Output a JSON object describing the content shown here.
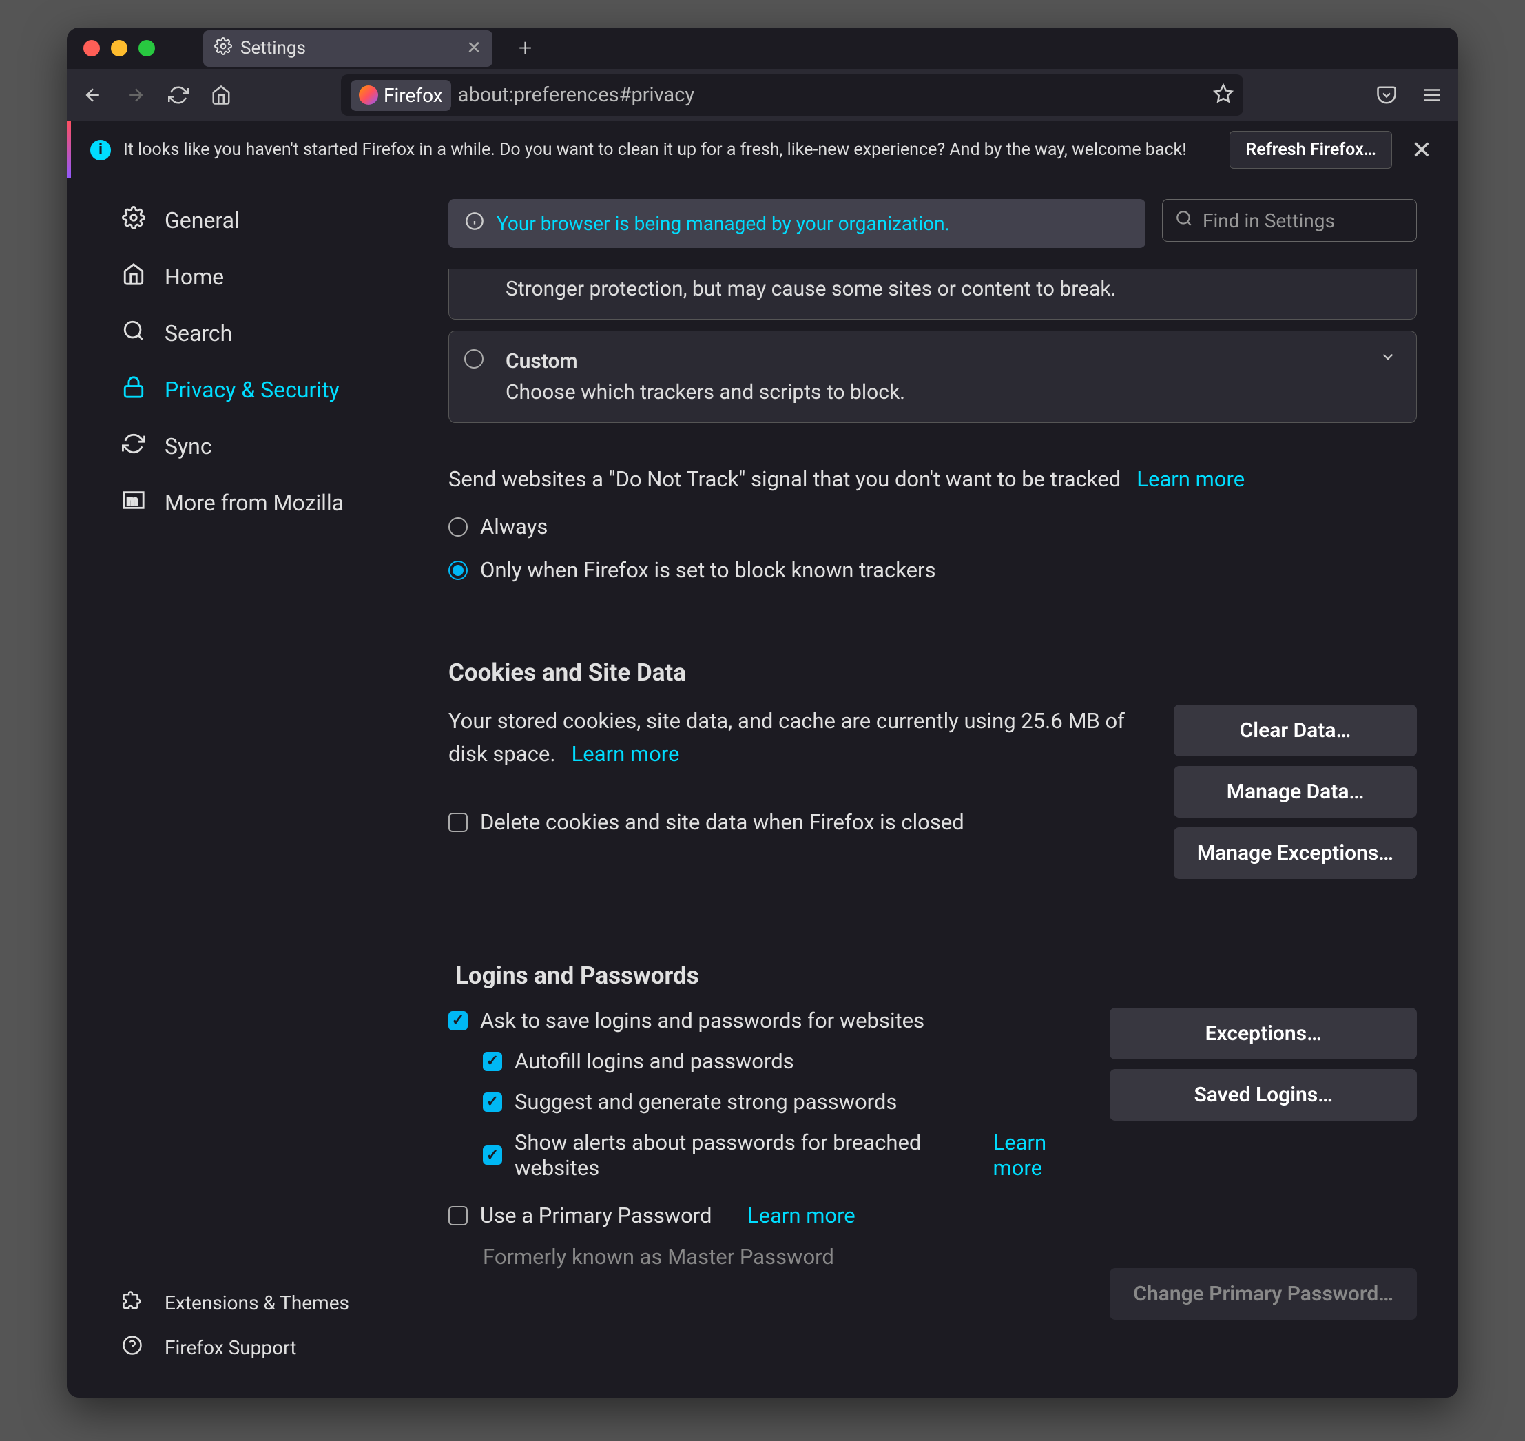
{
  "tab_title": "Settings",
  "url_badge": "Firefox",
  "url_text": "about:preferences#privacy",
  "notif": {
    "text": "It looks like you haven't started Firefox in a while. Do you want to clean it up for a fresh, like-new experience? And by the way, welcome back!",
    "button": "Refresh Firefox…"
  },
  "org_banner": "Your browser is being managed by your organization.",
  "search_placeholder": "Find in Settings",
  "sidebar": {
    "general": "General",
    "home": "Home",
    "search": "Search",
    "privacy": "Privacy & Security",
    "sync": "Sync",
    "more": "More from Mozilla",
    "ext": "Extensions & Themes",
    "support": "Firefox Support"
  },
  "tracking": {
    "strict_desc": "Stronger protection, but may cause some sites or content to break.",
    "custom_title": "Custom",
    "custom_desc": "Choose which trackers and scripts to block.",
    "dnt_text": "Send websites a \"Do Not Track\" signal that you don't want to be tracked",
    "learn_more": "Learn more",
    "always": "Always",
    "onlywhen": "Only when Firefox is set to block known trackers"
  },
  "cookies": {
    "heading": "Cookies and Site Data",
    "usage": "Your stored cookies, site data, and cache are currently using 25.6 MB of disk space.",
    "learn_more": "Learn more",
    "delete_on_close": "Delete cookies and site data when Firefox is closed",
    "clear": "Clear Data…",
    "manage": "Manage Data…",
    "exceptions": "Manage Exceptions…"
  },
  "logins": {
    "heading": "Logins and Passwords",
    "ask": "Ask to save logins and passwords for websites",
    "autofill": "Autofill logins and passwords",
    "suggest": "Suggest and generate strong passwords",
    "alerts": "Show alerts about passwords for breached websites",
    "learn_more": "Learn more",
    "primary": "Use a Primary Password",
    "primary_learn": "Learn more",
    "formerly": "Formerly known as Master Password",
    "exceptions": "Exceptions…",
    "saved": "Saved Logins…",
    "change": "Change Primary Password…"
  }
}
